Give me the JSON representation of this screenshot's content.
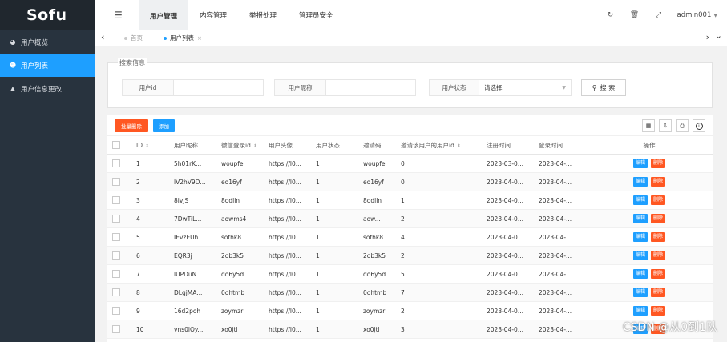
{
  "logo": "Sofu",
  "sidebar": {
    "items": [
      {
        "icon": "pie-chart-icon",
        "glyph": "◕",
        "label": "用户概览",
        "active": false
      },
      {
        "icon": "users-icon",
        "glyph": "☻",
        "label": "用户列表",
        "active": true
      },
      {
        "icon": "user-icon",
        "glyph": "▲",
        "label": "用户信息更改",
        "active": false
      }
    ]
  },
  "header": {
    "toggle_glyph": "☰",
    "menu": [
      {
        "label": "用户管理",
        "active": true
      },
      {
        "label": "内容管理",
        "active": false
      },
      {
        "label": "举报处理",
        "active": false
      },
      {
        "label": "管理员安全",
        "active": false
      }
    ],
    "icons": [
      {
        "name": "refresh-icon",
        "glyph": "↻"
      },
      {
        "name": "trash-icon",
        "glyph": "🗑"
      },
      {
        "name": "fullscreen-icon",
        "glyph": "⤢"
      }
    ],
    "user": "admin001",
    "user_caret": "▼"
  },
  "tabs": {
    "left_arrow": "‹",
    "right_arrow": "›",
    "more_arrow": "⌄",
    "items": [
      {
        "label": "首页",
        "active": false
      },
      {
        "label": "用户列表",
        "active": true,
        "close": "×"
      }
    ]
  },
  "search": {
    "legend": "搜索信息",
    "fields": [
      {
        "label": "用户id",
        "value": ""
      },
      {
        "label": "用户昵称",
        "value": ""
      },
      {
        "label": "用户状态",
        "value": "请选择"
      }
    ],
    "button": "搜 索"
  },
  "toolbar": {
    "batch_delete": "批量删除",
    "add": "添加",
    "icons": [
      {
        "name": "columns-icon",
        "glyph": "▦"
      },
      {
        "name": "export-icon",
        "glyph": "⇩"
      },
      {
        "name": "print-icon",
        "glyph": "⎙"
      },
      {
        "name": "info-icon",
        "glyph": "i"
      }
    ]
  },
  "table": {
    "columns": [
      "ID",
      "用户昵称",
      "微信登录id",
      "用户头像",
      "用户状态",
      "邀请码",
      "邀请该用户的用户id",
      "注册时间",
      "登录时间",
      "操作"
    ],
    "sortable": [
      true,
      false,
      true,
      false,
      false,
      false,
      true,
      false,
      false,
      false
    ],
    "edit_label": "编辑",
    "delete_label": "删除",
    "rows": [
      [
        "1",
        "5h01rK...",
        "woupfe",
        "https://l0...",
        "1",
        "woupfe",
        "0",
        "2023-03-0...",
        "2023-04-..."
      ],
      [
        "2",
        "lV2hV9D...",
        "eo16yf",
        "https://l0...",
        "1",
        "eo16yf",
        "0",
        "2023-04-0...",
        "2023-04-..."
      ],
      [
        "3",
        "8ivJS",
        "8odlln",
        "https://l0...",
        "1",
        "8odlln",
        "1",
        "2023-04-0...",
        "2023-04-..."
      ],
      [
        "4",
        "7DwTiL...",
        "aowms4",
        "https://l0...",
        "1",
        "aow...",
        "2",
        "2023-04-0...",
        "2023-04-..."
      ],
      [
        "5",
        "IEvzEUh",
        "sofhk8",
        "https://l0...",
        "1",
        "sofhk8",
        "4",
        "2023-04-0...",
        "2023-04-..."
      ],
      [
        "6",
        "EQR3j",
        "2ob3k5",
        "https://l0...",
        "1",
        "2ob3k5",
        "2",
        "2023-04-0...",
        "2023-04-..."
      ],
      [
        "7",
        "lUPDuN...",
        "do6y5d",
        "https://l0...",
        "1",
        "do6y5d",
        "5",
        "2023-04-0...",
        "2023-04-..."
      ],
      [
        "8",
        "DLgjMA...",
        "0ohtmb",
        "https://l0...",
        "1",
        "0ohtmb",
        "7",
        "2023-04-0...",
        "2023-04-..."
      ],
      [
        "9",
        "16d2poh",
        "zoymzr",
        "https://l0...",
        "1",
        "zoymzr",
        "2",
        "2023-04-0...",
        "2023-04-..."
      ],
      [
        "10",
        "vns0lOy...",
        "xo0jtl",
        "https://l0...",
        "1",
        "xo0jtl",
        "3",
        "2023-04-0...",
        "2023-04-..."
      ]
    ]
  },
  "watermark": "CSDN @从0到1队",
  "colors": {
    "accent": "#1e9fff",
    "danger": "#ff5722",
    "sidebar": "#28333e"
  }
}
